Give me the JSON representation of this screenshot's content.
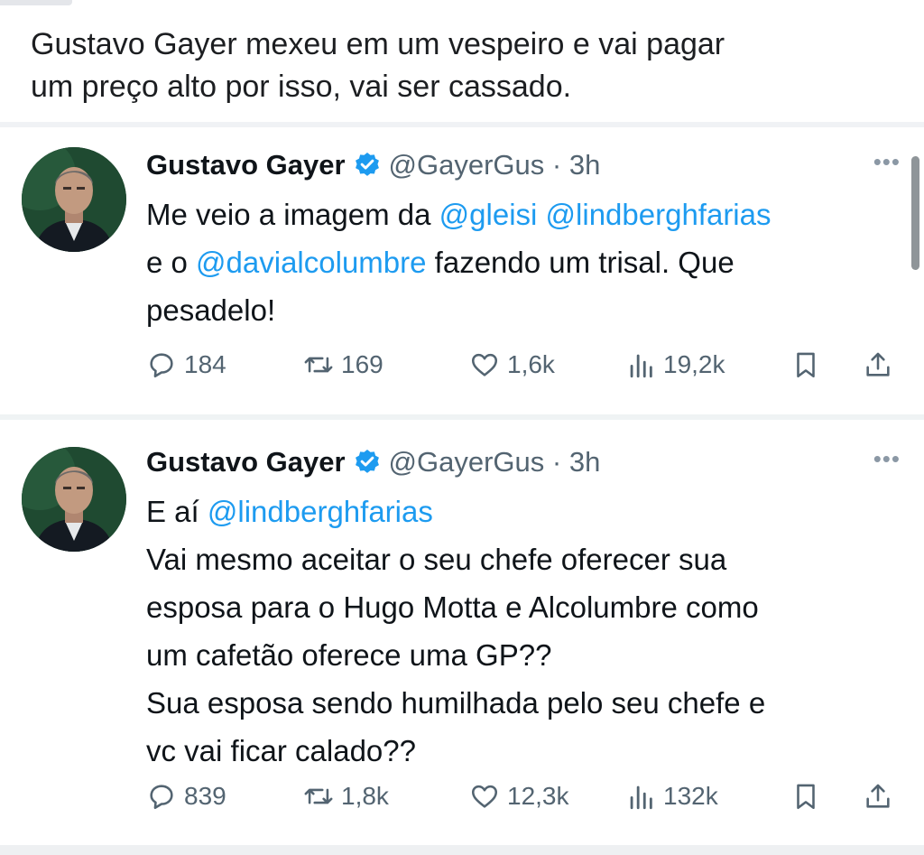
{
  "post": {
    "caption_line_1": "Gustavo Gayer mexeu em um vespeiro e vai pagar",
    "caption_line_2": "um preço alto por isso, vai ser cassado."
  },
  "colors": {
    "mention": "#1d9bf0",
    "verified": "#1d9bf0",
    "muted": "#536471",
    "text": "#0f1419"
  },
  "tweets": [
    {
      "author": "Gustavo Gayer",
      "handle_time": "@GayerGus · 3h",
      "more_icon": "more-horizontal-icon",
      "text": {
        "l1_pre": "Me veio a imagem da ",
        "l1_m1": "@gleisi",
        "l1_sp": " ",
        "l1_m2": "@lindberghfarias",
        "l2_pre": "e o ",
        "l2_m": "@davialcolumbre",
        "l2_post": " fazendo um trisal. Que",
        "l3": "pesadelo!"
      },
      "stats": {
        "replies": "184",
        "reposts": "169",
        "likes": "1,6k",
        "views": "19,2k"
      }
    },
    {
      "author": "Gustavo Gayer",
      "handle_time": "@GayerGus · 3h",
      "more_icon": "more-horizontal-icon",
      "text": {
        "l1_pre": "E aí ",
        "l1_m": "@lindberghfarias",
        "l2": "Vai mesmo aceitar o seu chefe oferecer sua",
        "l3": "esposa para o Hugo Motta e Alcolumbre como",
        "l4": "um cafetão oferece uma GP??",
        "l5": "Sua esposa sendo humilhada pelo seu chefe e",
        "l6": "vc vai ficar calado??"
      },
      "stats": {
        "replies": "839",
        "reposts": "1,8k",
        "likes": "12,3k",
        "views": "132k"
      }
    }
  ]
}
